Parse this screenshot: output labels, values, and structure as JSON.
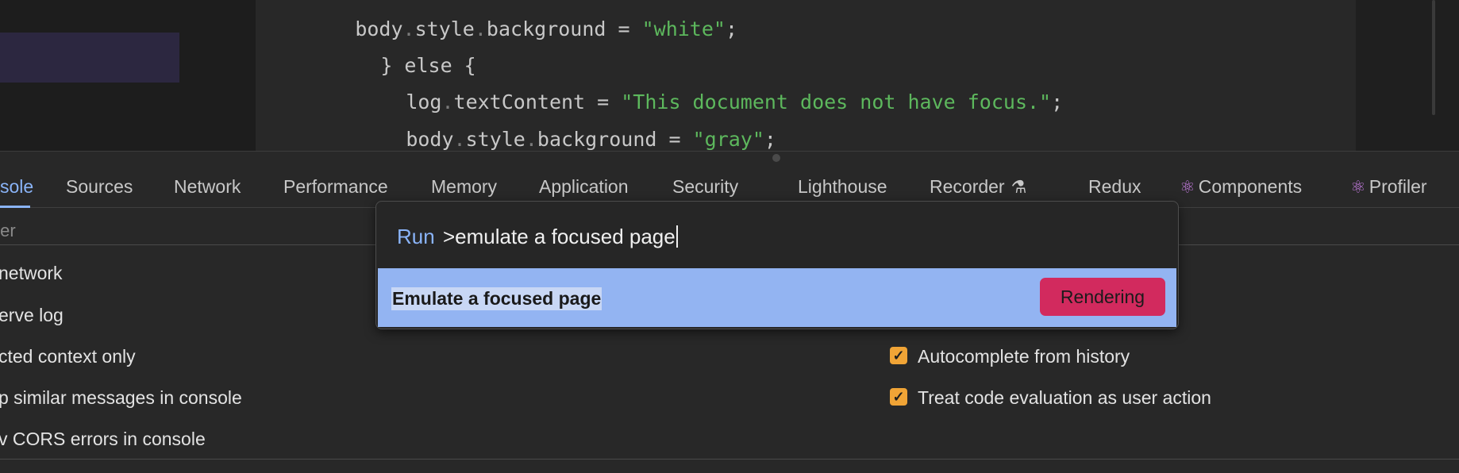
{
  "editor": {
    "lines": [
      {
        "indent": "  ",
        "parts": [
          [
            "body",
            ""
          ],
          [
            ".",
            "dot"
          ],
          [
            "style",
            ""
          ],
          [
            ".",
            "dot"
          ],
          [
            "background = ",
            ""
          ],
          [
            "\"white\"",
            "str"
          ],
          [
            ";",
            ""
          ]
        ]
      },
      {
        "indent": "",
        "parts": [
          [
            "} else {",
            ""
          ]
        ]
      },
      {
        "indent": "  ",
        "parts": [
          [
            "log",
            ""
          ],
          [
            ".",
            "dot"
          ],
          [
            "textContent = ",
            ""
          ],
          [
            "\"This document does not have focus.\"",
            "str"
          ],
          [
            ";",
            ""
          ]
        ]
      },
      {
        "indent": "  ",
        "parts": [
          [
            "body",
            ""
          ],
          [
            ".",
            "dot"
          ],
          [
            "style",
            ""
          ],
          [
            ".",
            "dot"
          ],
          [
            "background = ",
            ""
          ],
          [
            "\"gray\"",
            "str"
          ],
          [
            ";",
            ""
          ]
        ]
      },
      {
        "indent": "",
        "parts": [
          [
            "}",
            ""
          ]
        ]
      }
    ]
  },
  "tabs": [
    {
      "label": "sole",
      "active": true
    },
    {
      "label": "Sources"
    },
    {
      "label": "Network"
    },
    {
      "label": "Performance"
    },
    {
      "label": "Memory"
    },
    {
      "label": "Application"
    },
    {
      "label": "Security"
    },
    {
      "label": "Lighthouse"
    },
    {
      "label": "Recorder",
      "icon": "beaker-icon",
      "glyph": "⚗"
    },
    {
      "label": "Redux"
    },
    {
      "label": "Components",
      "icon": "react-icon",
      "glyph": "⚛"
    },
    {
      "label": "Profiler",
      "icon": "react-icon",
      "glyph": "⚛"
    }
  ],
  "filter": {
    "placeholder": "ter"
  },
  "settings": {
    "left": [
      "network",
      "erve log",
      "cted context only",
      "p similar messages in console",
      "v CORS errors in console"
    ],
    "right": [
      "Autocomplete from history",
      "Treat code evaluation as user action"
    ]
  },
  "command_menu": {
    "prefix": "Run",
    "query": ">emulate a focused page",
    "result": {
      "title": "Emulate a focused page",
      "badge": "Rendering"
    }
  },
  "colors": {
    "accent": "#8ab4f8",
    "badge": "#d22a5e",
    "checkbox": "#f0a436",
    "highlight": "#93b4f2"
  }
}
